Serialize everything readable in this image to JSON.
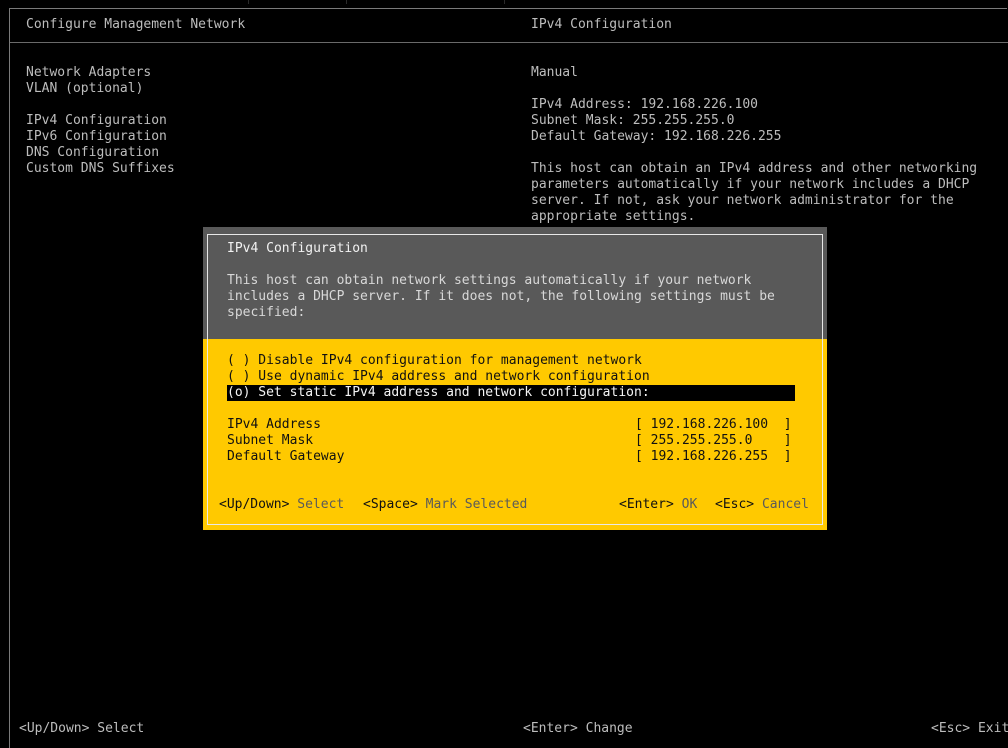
{
  "header": {
    "left_title": "Configure Management Network",
    "right_title": "IPv4 Configuration"
  },
  "menu": {
    "items": [
      "Network Adapters",
      "VLAN (optional)",
      "IPv4 Configuration",
      "IPv6 Configuration",
      "DNS Configuration",
      "Custom DNS Suffixes"
    ]
  },
  "info": {
    "mode": "Manual",
    "address": "IPv4 Address: 192.168.226.100",
    "mask": "Subnet Mask: 255.255.255.0",
    "gateway": "Default Gateway: 192.168.226.255",
    "desc": [
      "This host can obtain an IPv4 address and other networking",
      "parameters automatically if your network includes a DHCP",
      "server. If not, ask your network administrator for the",
      "appropriate settings."
    ]
  },
  "dialog": {
    "title": "IPv4 Configuration",
    "desc": [
      "This host can obtain network settings automatically if your network",
      "includes a DHCP server. If it does not, the following settings must be",
      "specified:"
    ],
    "options": [
      "( ) Disable IPv4 configuration for management network",
      "( ) Use dynamic IPv4 address and network configuration",
      "(o) Set static IPv4 address and network configuration:"
    ],
    "fields": [
      {
        "label": "IPv4 Address",
        "value": "[ 192.168.226.100  ]"
      },
      {
        "label": "Subnet Mask",
        "value": "[ 255.255.255.0    ]"
      },
      {
        "label": "Default Gateway",
        "value": "[ 192.168.226.255  ]"
      }
    ],
    "footer": {
      "updown_key": "<Up/Down>",
      "updown_action": "Select",
      "space_key": "<Space>",
      "space_action": "Mark Selected",
      "enter_key": "<Enter>",
      "enter_action": "OK",
      "esc_key": "<Esc>",
      "esc_action": "Cancel"
    }
  },
  "bottom": {
    "left": "<Up/Down> Select",
    "center": "<Enter> Change",
    "right": "<Esc> Exit"
  }
}
